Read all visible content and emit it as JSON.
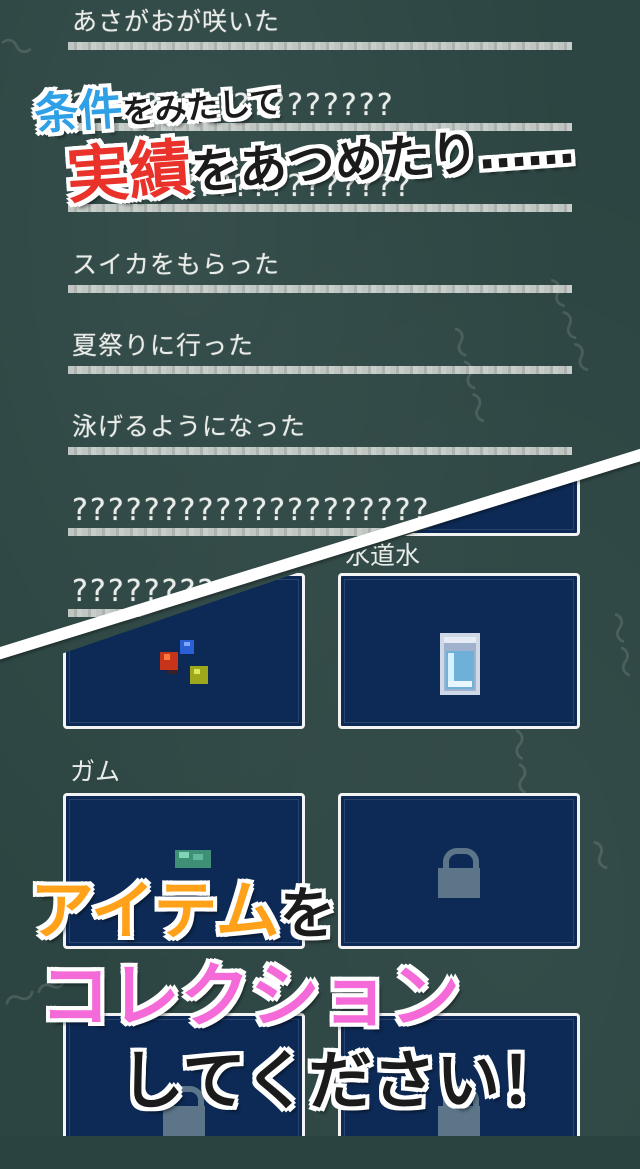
{
  "achievements": [
    {
      "label": "あさがおが咲いた"
    },
    {
      "label": "??????????????????"
    },
    {
      "label": "???????????????????"
    },
    {
      "label": "スイカをもらった"
    },
    {
      "label": "夏祭りに行った"
    },
    {
      "label": "泳げるようになった"
    },
    {
      "label": "????????????????????"
    },
    {
      "label": "????????"
    }
  ],
  "items": {
    "label_top_right": "水道水",
    "label_gum": "ガム"
  },
  "promo": {
    "line1_part1": "条件",
    "line1_part2": "をみたして",
    "line2_part1": "実績",
    "line2_part2": "をあつめたり……",
    "line3_part1": "アイテム",
    "line3_part2": "を",
    "line4": "コレクション",
    "line5": "してください！"
  },
  "colors": {
    "promo_blue": "#2f9fe6",
    "promo_red": "#e8322a",
    "promo_orange": "#ffa21a",
    "promo_pink": "#f36ad8",
    "item_box": "#0d2a56",
    "board": "#2c4542"
  },
  "icons": [
    "marbles-icon",
    "glass-of-water-icon",
    "gum-icon",
    "lock-icon"
  ]
}
